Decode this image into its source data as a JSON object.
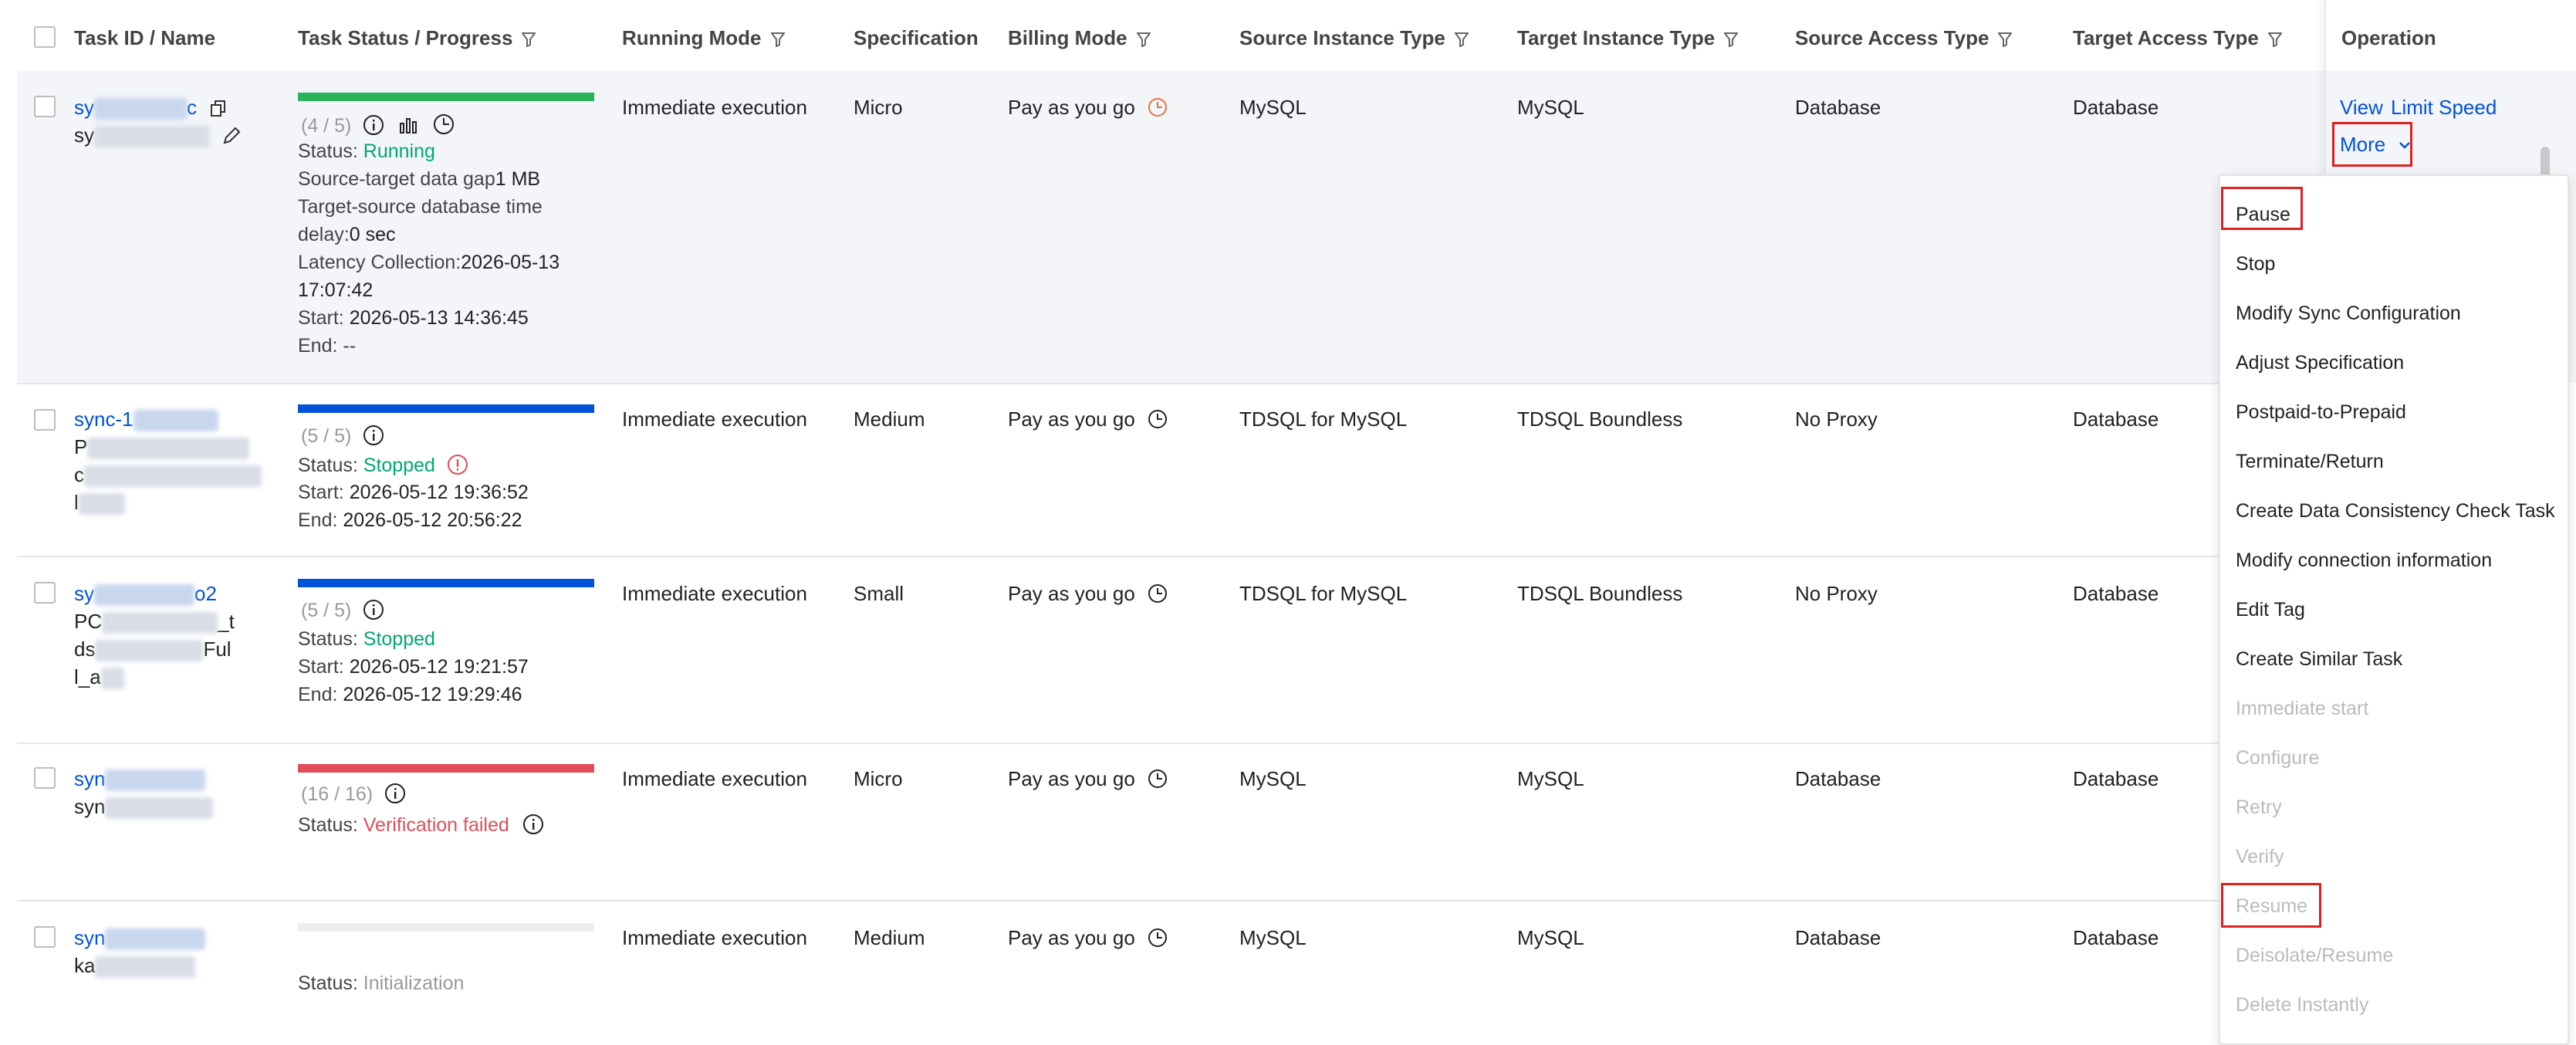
{
  "table": {
    "headers": {
      "task_id_name": "Task ID / Name",
      "task_status_progress": "Task Status / Progress",
      "running_mode": "Running Mode",
      "specification": "Specification",
      "billing_mode": "Billing Mode",
      "source_instance_type": "Source Instance Type",
      "target_instance_type": "Target Instance Type",
      "source_access_type": "Source Access Type",
      "target_access_type": "Target Access Type",
      "operation": "Operation"
    },
    "rows": [
      {
        "id_prefix": "sy",
        "id_suffix": "c",
        "name_prefix": "sy",
        "progress": "(4 / 5)",
        "progress_fraction": 1.0,
        "progress_color": "#29b45a",
        "status_label": "Status: ",
        "status": "Running",
        "gap_label": "Source-target data gap",
        "gap_value": "1 MB",
        "delay_label_1": "Target-source database time",
        "delay_label_2": "delay:",
        "delay_value": "0 sec",
        "latency_label": "Latency Collection:",
        "latency_value_1": "2026-05-13",
        "latency_value_2": "17:07:42",
        "start_label": "Start: ",
        "start": "2026-05-13 14:36:45",
        "end_label": "End: ",
        "end": "--",
        "running_mode": "Immediate execution",
        "specification": "Micro",
        "billing": "Pay as you go",
        "billing_icon_color": "#e8743b",
        "source_instance": "MySQL",
        "target_instance": "MySQL",
        "source_access": "Database",
        "target_access": "Database"
      },
      {
        "id_prefix": "sync-1",
        "name_prefix_1": "P",
        "name_prefix_2": "c",
        "name_prefix_3": "l",
        "progress": "(5 / 5)",
        "progress_fraction": 1.0,
        "progress_color": "#0052d9",
        "status_label": "Status: ",
        "status": "Stopped",
        "start_label": "Start: ",
        "start": "2026-05-12 19:36:52",
        "end_label": "End: ",
        "end": "2026-05-12 20:56:22",
        "running_mode": "Immediate execution",
        "specification": "Medium",
        "billing": "Pay as you go",
        "source_instance": "TDSQL for MySQL",
        "target_instance": "TDSQL Boundless",
        "source_access": "No Proxy",
        "target_access": "Database"
      },
      {
        "id_prefix": "sy",
        "id_suffix": "o2",
        "name_line_1a": "PC",
        "name_line_1b": "_t",
        "name_line_2a": "ds",
        "name_line_2b": "Ful",
        "name_line_3": "l_a",
        "progress": "(5 / 5)",
        "progress_fraction": 1.0,
        "progress_color": "#0052d9",
        "status_label": "Status: ",
        "status": "Stopped",
        "start_label": "Start: ",
        "start": "2026-05-12 19:21:57",
        "end_label": "End: ",
        "end": "2026-05-12 19:29:46",
        "running_mode": "Immediate execution",
        "specification": "Small",
        "billing": "Pay as you go",
        "source_instance": "TDSQL for MySQL",
        "target_instance": "TDSQL Boundless",
        "source_access": "No Proxy",
        "target_access": "Database"
      },
      {
        "id_prefix": "syn",
        "name_prefix": "syn",
        "progress": "(16 / 16)",
        "progress_fraction": 1.0,
        "progress_color": "#e34d59",
        "status_label": "Status: ",
        "status": "Verification failed",
        "running_mode": "Immediate execution",
        "specification": "Micro",
        "billing": "Pay as you go",
        "source_instance": "MySQL",
        "target_instance": "MySQL",
        "source_access": "Database",
        "target_access": "Database"
      },
      {
        "id_prefix": "syn",
        "name_prefix": "ka",
        "progress_fraction": 0.0,
        "status_label": "Status: ",
        "status": "Initialization",
        "running_mode": "Immediate execution",
        "specification": "Medium",
        "billing": "Pay as you go",
        "source_instance": "MySQL",
        "target_instance": "MySQL",
        "source_access": "Database",
        "target_access": "Database"
      }
    ]
  },
  "operation": {
    "view": "View",
    "limit_speed": "Limit Speed",
    "more": "More"
  },
  "more_menu": {
    "items": [
      {
        "label": "Pause",
        "enabled": true,
        "highlighted": true
      },
      {
        "label": "Stop",
        "enabled": true
      },
      {
        "label": "Modify Sync Configuration",
        "enabled": true
      },
      {
        "label": "Adjust Specification",
        "enabled": true
      },
      {
        "label": "Postpaid-to-Prepaid",
        "enabled": true
      },
      {
        "label": "Terminate/Return",
        "enabled": true
      },
      {
        "label": "Create Data Consistency Check Task",
        "enabled": true
      },
      {
        "label": "Modify connection information",
        "enabled": true
      },
      {
        "label": "Edit Tag",
        "enabled": true
      },
      {
        "label": "Create Similar Task",
        "enabled": true
      },
      {
        "label": "Immediate start",
        "enabled": false
      },
      {
        "label": "Configure",
        "enabled": false
      },
      {
        "label": "Retry",
        "enabled": false
      },
      {
        "label": "Verify",
        "enabled": false
      },
      {
        "label": "Resume",
        "enabled": false,
        "highlighted": true
      },
      {
        "label": "Deisolate/Resume",
        "enabled": false
      },
      {
        "label": "Delete Instantly",
        "enabled": false
      }
    ]
  },
  "colors": {
    "link": "#0052d9",
    "running": "#00a870",
    "stopped": "#00a870",
    "failed": "#e34d59",
    "highlight_border": "#e02020"
  }
}
